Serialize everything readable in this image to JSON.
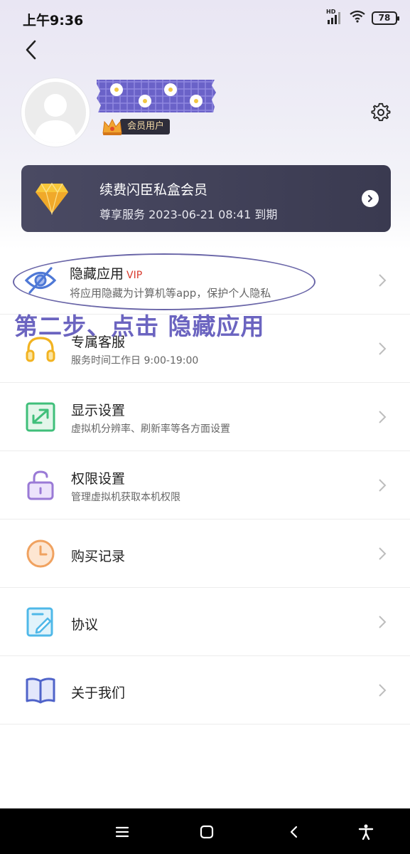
{
  "status_bar": {
    "time": "上午9:36",
    "signal_tag": "HD",
    "battery": "78"
  },
  "profile": {
    "member_label": "会员用户"
  },
  "vip_card": {
    "title": "续费闪臣私盒会员",
    "expire_text": "尊享服务 2023-06-21 08:41 到期"
  },
  "menu": [
    {
      "title": "隐藏应用",
      "tag": "VIP",
      "subtitle": "将应用隐藏为计算机等app，保护个人隐私",
      "icon": "eye-hidden-icon"
    },
    {
      "title": "专属客服",
      "subtitle": "服务时间工作日 9:00-19:00",
      "icon": "headphones-icon"
    },
    {
      "title": "显示设置",
      "subtitle": "虚拟机分辨率、刷新率等各方面设置",
      "icon": "expand-icon"
    },
    {
      "title": "权限设置",
      "subtitle": "管理虚拟机获取本机权限",
      "icon": "lock-icon"
    },
    {
      "title": "购买记录",
      "icon": "clock-icon"
    },
    {
      "title": "协议",
      "icon": "document-edit-icon"
    },
    {
      "title": "关于我们",
      "icon": "book-icon"
    }
  ],
  "annotation": {
    "instruction": "第二步、点击 隐藏应用"
  },
  "colors": {
    "vip_card_bg": "#42425a",
    "vip_tag": "#d83a2c",
    "annotation": "#6b64c0",
    "eye_icon": "#4e78d6",
    "headphones_icon": "#f2b321",
    "expand_icon": "#3fbf7a",
    "lock_icon": "#9a7ad6",
    "clock_icon": "#f0a260",
    "doc_icon": "#4fb8e8",
    "book_icon": "#4f63c9"
  }
}
